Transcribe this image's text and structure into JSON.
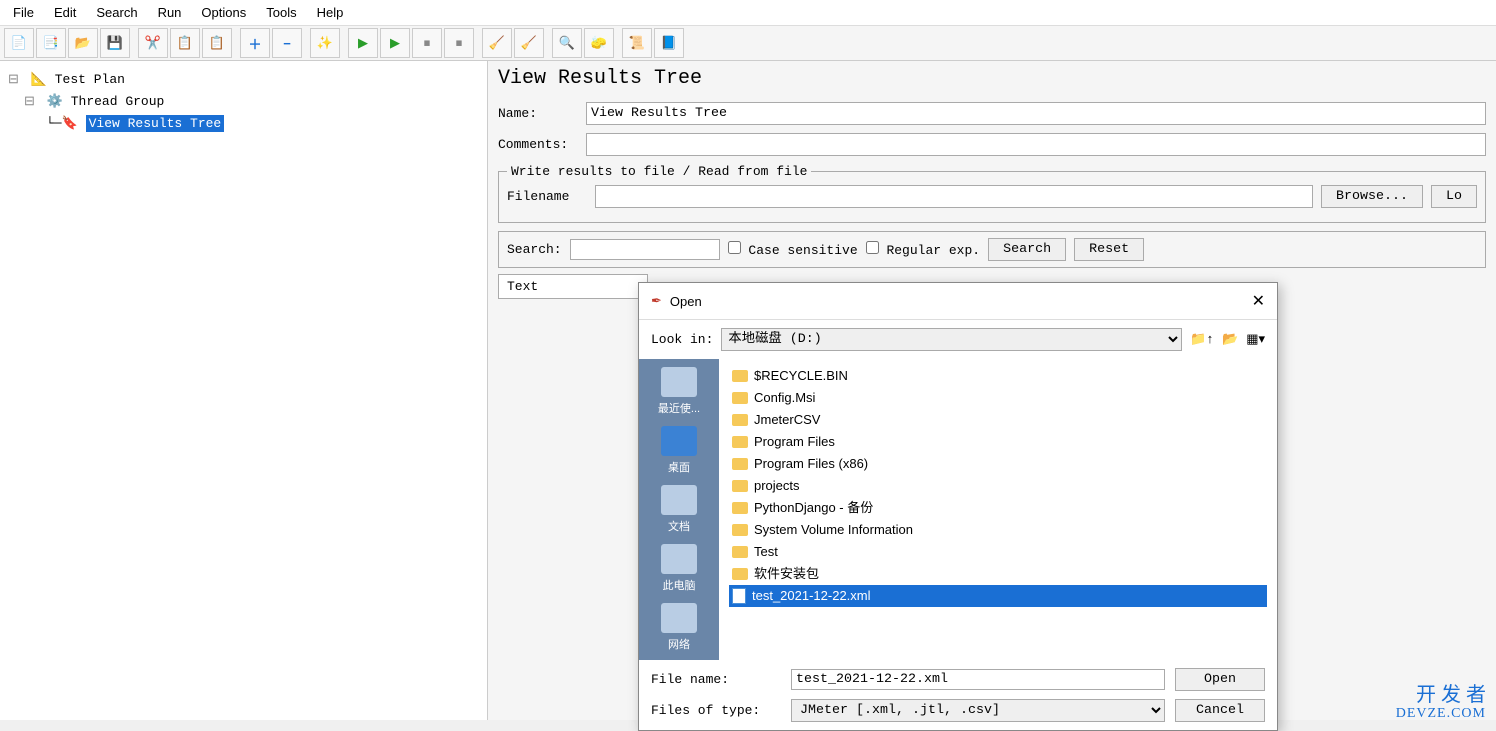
{
  "menubar": [
    "File",
    "Edit",
    "Search",
    "Run",
    "Options",
    "Tools",
    "Help"
  ],
  "toolbar_icons": [
    "new-file",
    "open-template",
    "open",
    "save",
    "",
    "cut",
    "copy",
    "paste",
    "",
    "add",
    "remove",
    "",
    "wand",
    "",
    "run",
    "run-no-pause",
    "stop",
    "stop-all",
    "",
    "clean1",
    "clean2",
    "",
    "binoculars",
    "broom",
    "",
    "list",
    "props"
  ],
  "tree": {
    "root": "Test Plan",
    "group": "Thread Group",
    "listener": "View Results Tree"
  },
  "panel": {
    "title": "View Results Tree",
    "name_label": "Name:",
    "name_value": "View Results Tree",
    "comments_label": "Comments:",
    "comments_value": "",
    "fieldset_legend": "Write results to file / Read from file",
    "filename_label": "Filename",
    "filename_value": "",
    "browse_btn": "Browse...",
    "lo_btn": "Lo",
    "search_label": "Search:",
    "case_sensitive": "Case sensitive",
    "regular_exp": "Regular exp.",
    "search_btn": "Search",
    "reset_btn": "Reset",
    "text_label": "Text"
  },
  "dialog": {
    "title": "Open",
    "lookin_label": "Look in:",
    "lookin_value": "本地磁盘 (D:)",
    "places": [
      "最近使...",
      "桌面",
      "文档",
      "此电脑",
      "网络"
    ],
    "files": [
      {
        "name": "$RECYCLE.BIN",
        "type": "folder"
      },
      {
        "name": "Config.Msi",
        "type": "folder"
      },
      {
        "name": "JmeterCSV",
        "type": "folder"
      },
      {
        "name": "Program Files",
        "type": "folder"
      },
      {
        "name": "Program Files (x86)",
        "type": "folder"
      },
      {
        "name": "projects",
        "type": "folder"
      },
      {
        "name": "PythonDjango - 备份",
        "type": "folder"
      },
      {
        "name": "System Volume Information",
        "type": "folder"
      },
      {
        "name": "Test",
        "type": "folder"
      },
      {
        "name": "软件安装包",
        "type": "folder"
      },
      {
        "name": "test_2021-12-22.xml",
        "type": "file",
        "selected": true
      }
    ],
    "filename_label": "File name:",
    "filename_value": "test_2021-12-22.xml",
    "filetype_label": "Files of type:",
    "filetype_value": "JMeter [.xml, .jtl, .csv]",
    "open_btn": "Open",
    "cancel_btn": "Cancel"
  },
  "watermark": {
    "line1": "开 发 者",
    "line2": "DEVZE.COM"
  },
  "colors": {
    "accent": "#1a6fd4",
    "sidebar": "#6a86a8"
  }
}
